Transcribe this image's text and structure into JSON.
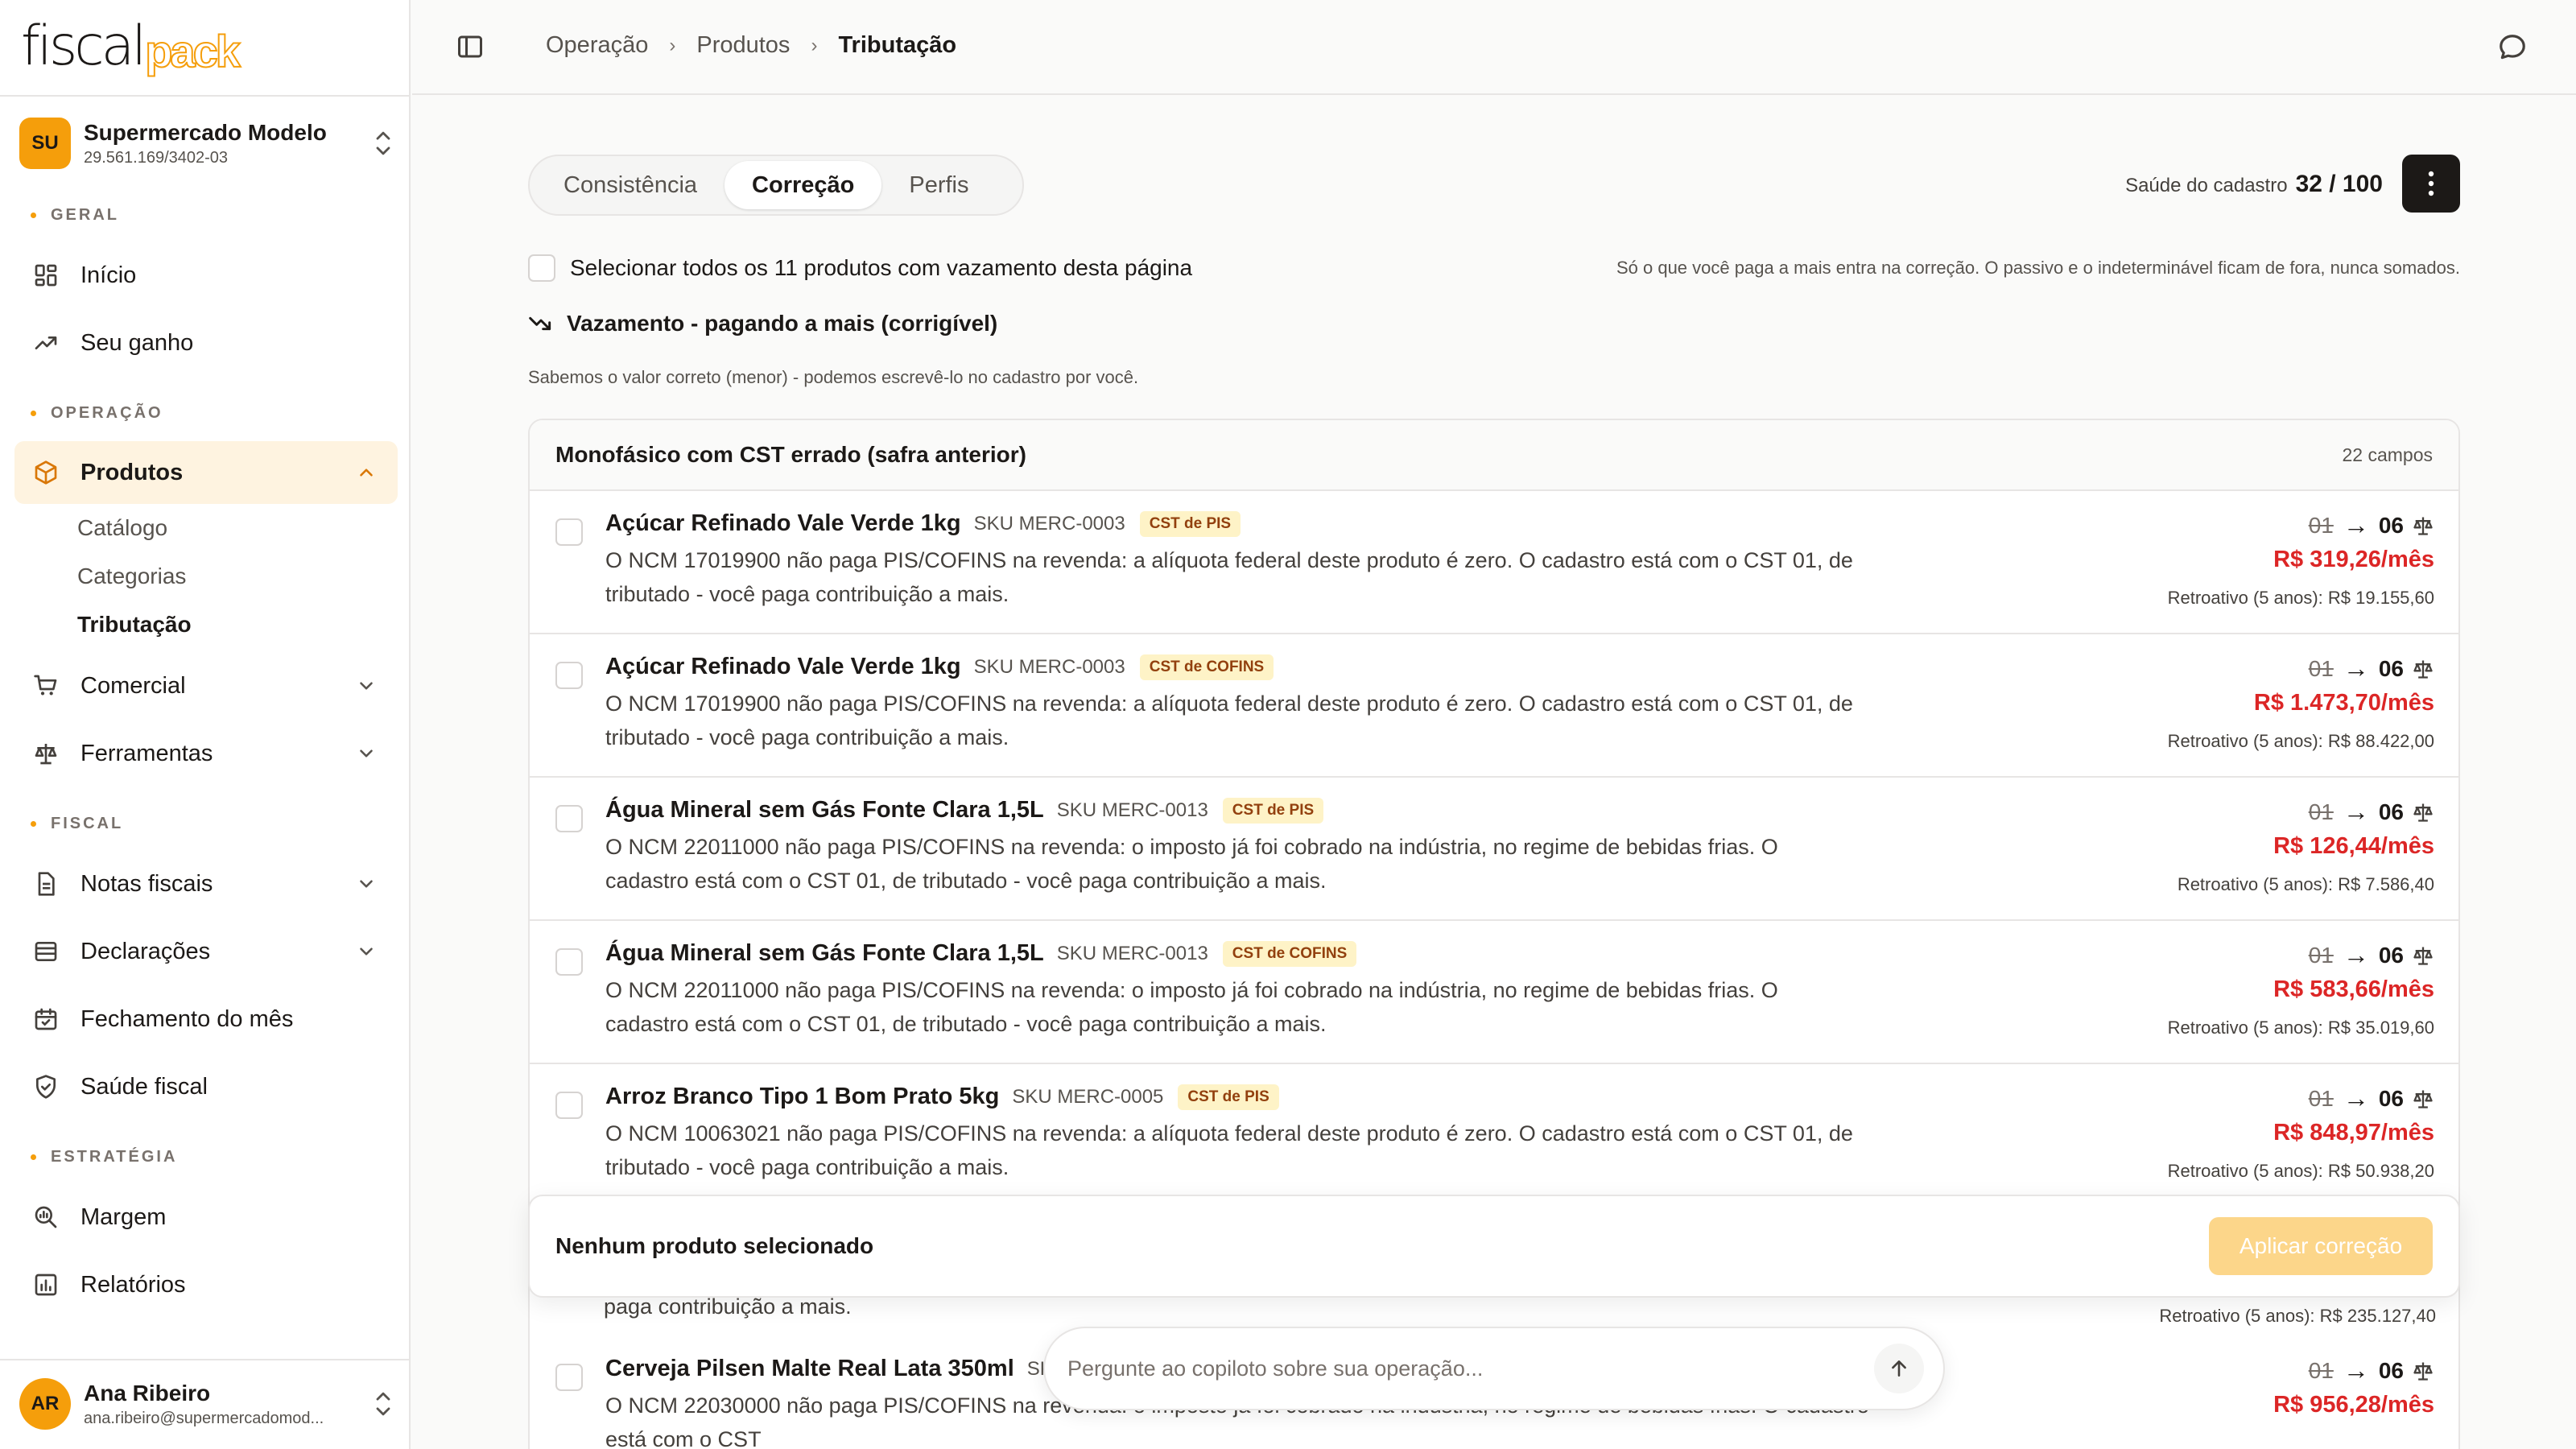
{
  "brand": {
    "part1": "fiscal",
    "part2": "pack"
  },
  "org": {
    "initials": "SU",
    "name": "Supermercado Modelo",
    "cnpj": "29.561.169/3402-03"
  },
  "nav": {
    "section_geral": "GERAL",
    "inicio": "Início",
    "seu_ganho": "Seu ganho",
    "section_operacao": "OPERAÇÃO",
    "produtos": "Produtos",
    "catalogo": "Catálogo",
    "categorias": "Categorias",
    "tributacao": "Tributação",
    "comercial": "Comercial",
    "ferramentas": "Ferramentas",
    "section_fiscal": "FISCAL",
    "notas_fiscais": "Notas fiscais",
    "declaracoes": "Declarações",
    "fechamento": "Fechamento do mês",
    "saude_fiscal": "Saúde fiscal",
    "section_estrategia": "ESTRATÉGIA",
    "margem": "Margem",
    "relatorios": "Relatórios"
  },
  "user": {
    "initials": "AR",
    "name": "Ana Ribeiro",
    "email": "ana.ribeiro@supermercadomod..."
  },
  "breadcrumb": [
    "Operação",
    "Produtos",
    "Tributação"
  ],
  "tabs": [
    "Consistência",
    "Correção",
    "Perfis"
  ],
  "health": {
    "label": "Saúde do cadastro",
    "value": "32 / 100"
  },
  "select_all": "Selecionar todos os 11 produtos com vazamento desta página",
  "note": "Só o que você paga a mais entra na correção. O passivo e o indeterminável ficam de fora, nunca somados.",
  "leak": {
    "title": "Vazamento - pagando a mais (corrigível)",
    "desc": "Sabemos o valor correto (menor) - podemos escrevê-lo no cadastro por você."
  },
  "panel": {
    "title": "Monofásico com CST errado (safra anterior)",
    "count": "22 campos"
  },
  "rows": [
    {
      "name": "Açúcar Refinado Vale Verde 1kg",
      "sku": "SKU MERC-0003",
      "tag": "CST de PIS",
      "desc": "O NCM 17019900 não paga PIS/COFINS na revenda: a alíquota federal deste produto é zero. O cadastro está com o CST 01, de tributado - você paga contribuição a mais.",
      "from": "01",
      "to": "06",
      "amount": "R$ 319,26/mês",
      "retro": "Retroativo (5 anos): R$ 19.155,60"
    },
    {
      "name": "Açúcar Refinado Vale Verde 1kg",
      "sku": "SKU MERC-0003",
      "tag": "CST de COFINS",
      "desc": "O NCM 17019900 não paga PIS/COFINS na revenda: a alíquota federal deste produto é zero. O cadastro está com o CST 01, de tributado - você paga contribuição a mais.",
      "from": "01",
      "to": "06",
      "amount": "R$ 1.473,70/mês",
      "retro": "Retroativo (5 anos): R$ 88.422,00"
    },
    {
      "name": "Água Mineral sem Gás Fonte Clara 1,5L",
      "sku": "SKU MERC-0013",
      "tag": "CST de PIS",
      "desc": "O NCM 22011000 não paga PIS/COFINS na revenda: o imposto já foi cobrado na indústria, no regime de bebidas frias. O cadastro está com o CST 01, de tributado - você paga contribuição a mais.",
      "from": "01",
      "to": "06",
      "amount": "R$ 126,44/mês",
      "retro": "Retroativo (5 anos): R$ 7.586,40"
    },
    {
      "name": "Água Mineral sem Gás Fonte Clara 1,5L",
      "sku": "SKU MERC-0013",
      "tag": "CST de COFINS",
      "desc": "O NCM 22011000 não paga PIS/COFINS na revenda: o imposto já foi cobrado na indústria, no regime de bebidas frias. O cadastro está com o CST 01, de tributado - você paga contribuição a mais.",
      "from": "01",
      "to": "06",
      "amount": "R$ 583,66/mês",
      "retro": "Retroativo (5 anos): R$ 35.019,60"
    },
    {
      "name": "Arroz Branco Tipo 1 Bom Prato 5kg",
      "sku": "SKU MERC-0005",
      "tag": "CST de PIS",
      "desc": "O NCM 10063021 não paga PIS/COFINS na revenda: a alíquota federal deste produto é zero. O cadastro está com o CST 01, de tributado - você paga contribuição a mais.",
      "from": "01",
      "to": "06",
      "amount": "R$ 848,97/mês",
      "retro": "Retroativo (5 anos): R$ 50.938,20"
    }
  ],
  "hidden_row": {
    "desc_tail": "paga contribuição a mais.",
    "retro": "Retroativo (5 anos): R$ 235.127,40"
  },
  "last_row": {
    "name": "Cerveja Pilsen Malte Real Lata 350ml",
    "sku_fragment": "SK",
    "desc": "O NCM 22030000 não paga PIS/COFINS na revenda: o imposto já foi cobrado na indústria, no regime de bebidas frias. O cadastro está com o CST",
    "from": "01",
    "to": "06",
    "amount": "R$ 956,28/mês"
  },
  "selection": {
    "status": "Nenhum produto selecionado",
    "apply": "Aplicar correção"
  },
  "copilot": {
    "placeholder": "Pergunte ao copiloto sobre sua operação..."
  }
}
